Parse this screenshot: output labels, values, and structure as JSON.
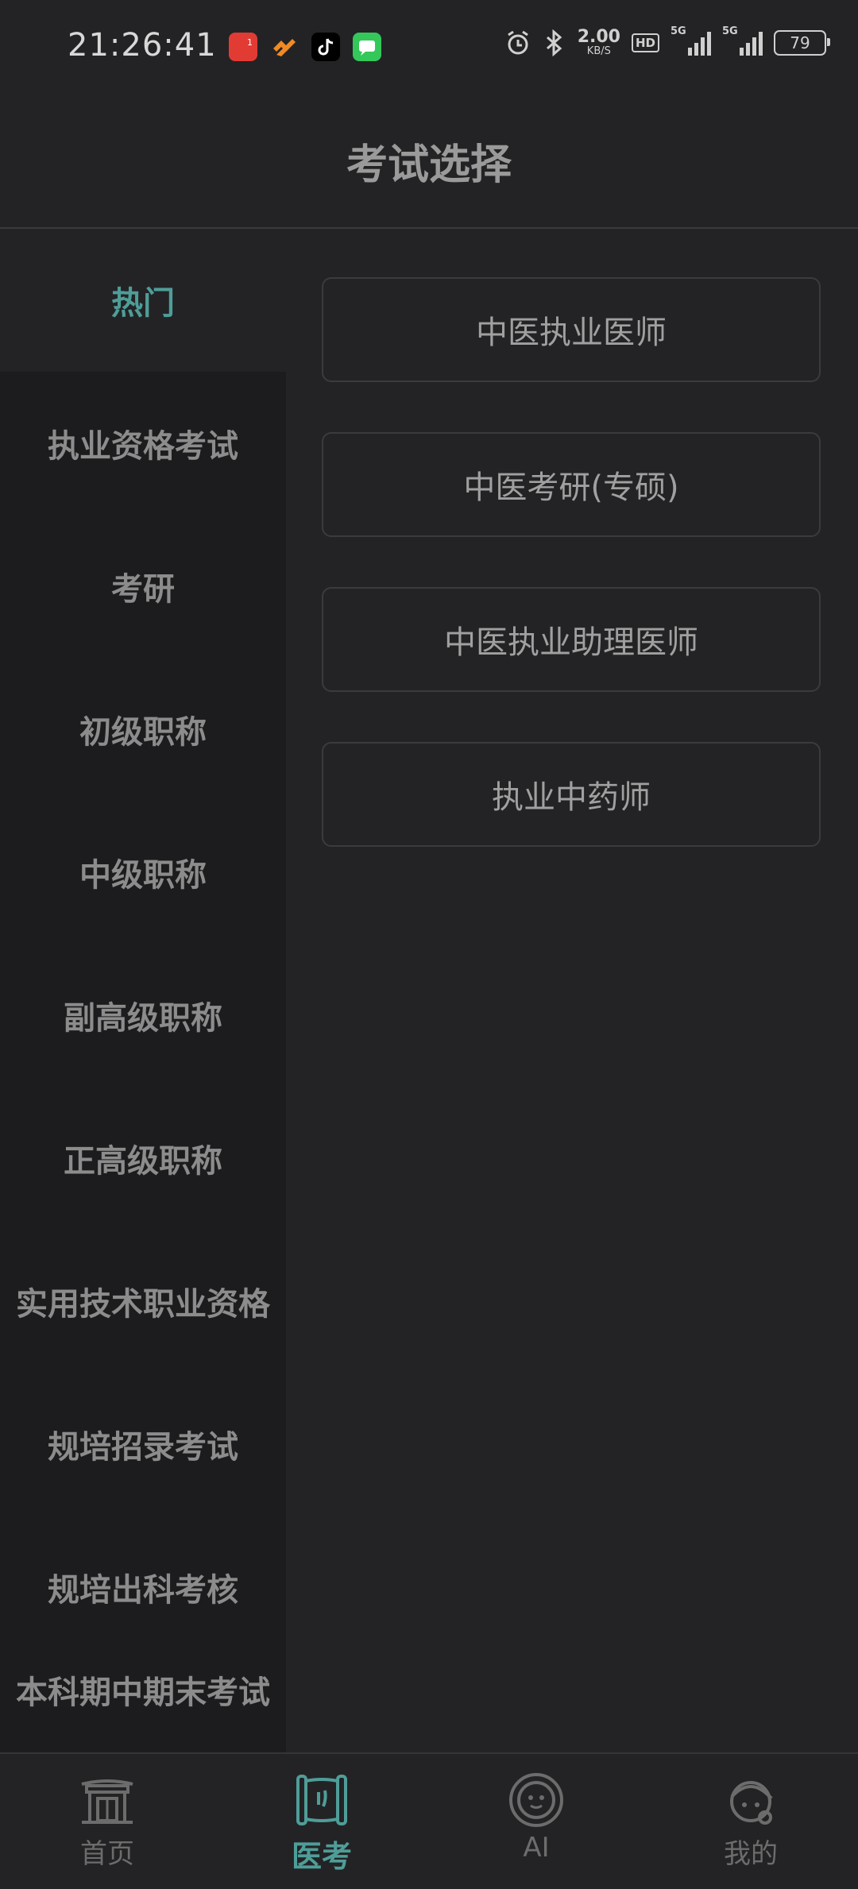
{
  "status_bar": {
    "time": "21:26:41",
    "notification_badge": "1",
    "network_speed_value": "2.00",
    "network_speed_unit": "KB/S",
    "hd_label": "HD",
    "signal_1_label": "5G",
    "signal_2_label": "5G",
    "battery_level": "79"
  },
  "header": {
    "title": "考试选择"
  },
  "sidebar": {
    "items": [
      {
        "label": "热门",
        "active": true
      },
      {
        "label": "执业资格考试"
      },
      {
        "label": "考研"
      },
      {
        "label": "初级职称"
      },
      {
        "label": "中级职称"
      },
      {
        "label": "副高级职称"
      },
      {
        "label": "正高级职称"
      },
      {
        "label": "实用技术职业资格"
      },
      {
        "label": "规培招录考试"
      },
      {
        "label": "规培出科考核"
      },
      {
        "label": "本科期中期末考试"
      }
    ]
  },
  "exams": [
    {
      "label": "中医执业医师"
    },
    {
      "label": "中医考研(专硕)"
    },
    {
      "label": "中医执业助理医师"
    },
    {
      "label": "执业中药师"
    }
  ],
  "bottom_nav": {
    "items": [
      {
        "label": "首页",
        "icon": "home-gate-icon"
      },
      {
        "label": "医考",
        "icon": "scroll-icon",
        "active": true
      },
      {
        "label": "AI",
        "icon": "ai-robot-icon"
      },
      {
        "label": "我的",
        "icon": "profile-icon"
      }
    ]
  },
  "colors": {
    "accent": "#4f9d98",
    "background": "#232325",
    "sidebar_background": "#1c1c1e"
  }
}
